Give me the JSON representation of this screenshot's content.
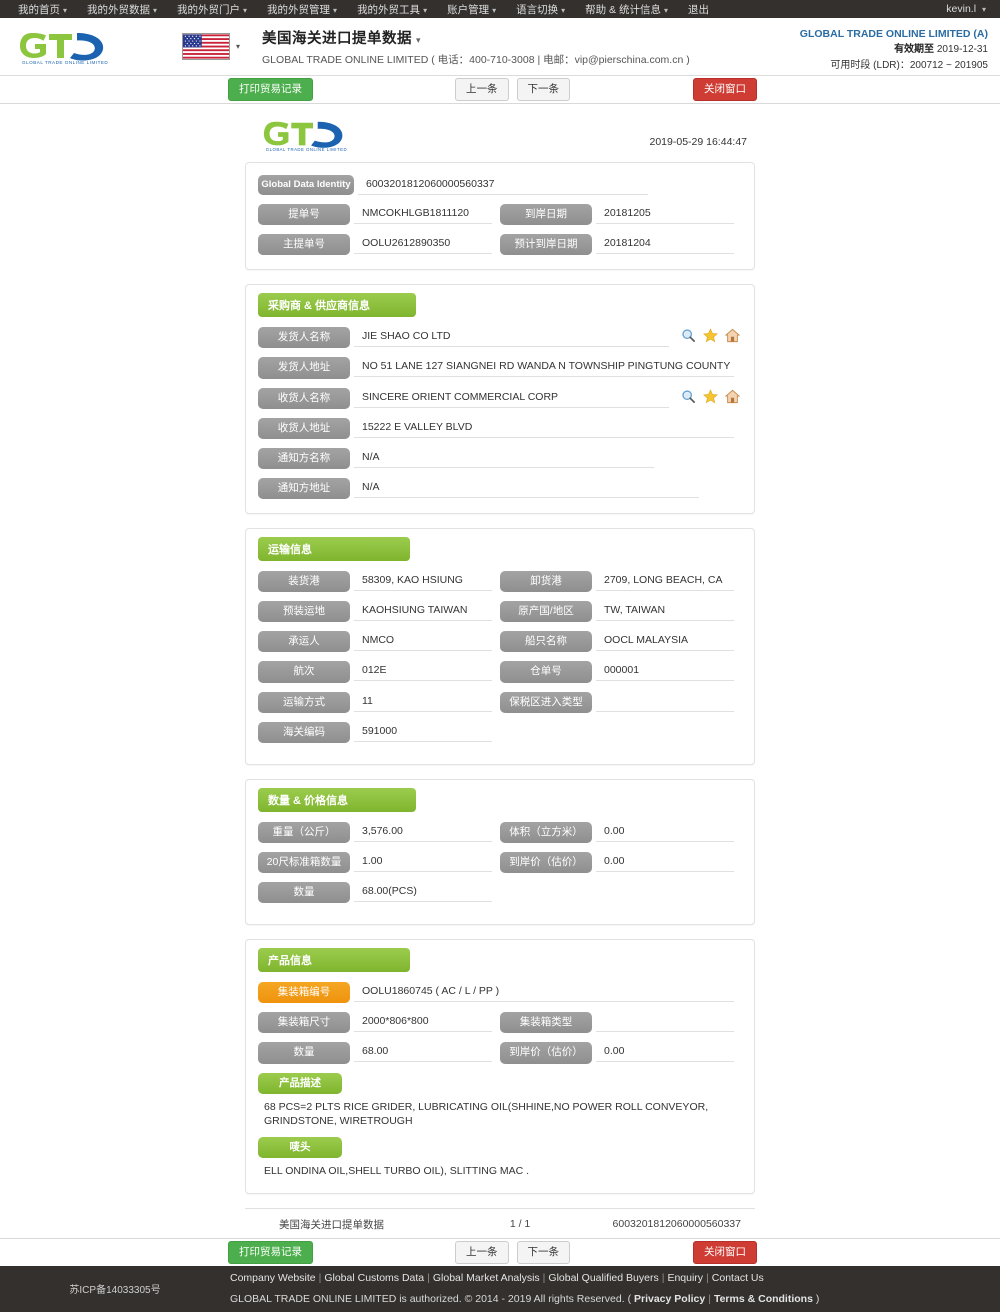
{
  "topnav": {
    "items": [
      {
        "label": "我的首页",
        "caret": true
      },
      {
        "label": "我的外贸数据",
        "caret": true
      },
      {
        "label": "我的外贸门户",
        "caret": true
      },
      {
        "label": "我的外贸管理",
        "caret": true
      },
      {
        "label": "我的外贸工具",
        "caret": true
      },
      {
        "label": "账户管理",
        "caret": true
      },
      {
        "label": "语言切换",
        "caret": true
      },
      {
        "label": "帮助 & 统计信息",
        "caret": true
      },
      {
        "label": "退出",
        "caret": false
      }
    ],
    "user": "kevin.l",
    "user_caret": "▾"
  },
  "header": {
    "logo_text": "GLOBAL TRADE ONLINE LIMITED",
    "flag": "us-flag-icon",
    "title": "美国海关进口提单数据",
    "title_caret": "▾",
    "subtitle": "GLOBAL TRADE ONLINE LIMITED ( 电话：400-710-3008 | 电邮：vip@pierschina.com.cn )",
    "account_name": "GLOBAL TRADE ONLINE LIMITED (A)",
    "valid_label": "有效期至",
    "valid_value": "2019-12-31",
    "ldr_label": "可用时段 (LDR)：",
    "ldr_value": "200712 ~ 201905"
  },
  "actionbar": {
    "print": "打印贸易记录",
    "prev": "上一条",
    "next": "下一条",
    "close": "关闭窗口"
  },
  "doc": {
    "timestamp": "2019-05-29 16:44:47",
    "identity": {
      "label": "Global Data Identity",
      "value": "6003201812060000560337"
    },
    "basic": [
      {
        "label": "提单号",
        "value": "NMCOKHLGB1811120"
      },
      {
        "label": "到岸日期",
        "value": "20181205"
      },
      {
        "label": "主提单号",
        "value": "OOLU2612890350"
      },
      {
        "label": "预计到岸日期",
        "value": "20181204"
      }
    ],
    "parties": {
      "title": "采购商 & 供应商信息",
      "fields": [
        {
          "label": "发货人名称",
          "value": "JIE SHAO CO LTD"
        },
        {
          "label": "发货人地址",
          "value": "NO 51 LANE 127 SIANGNEI RD WANDA N TOWNSHIP PINGTUNG COUNTY"
        },
        {
          "label": "收货人名称",
          "value": "SINCERE ORIENT COMMERCIAL CORP"
        },
        {
          "label": "收货人地址",
          "value": "15222 E VALLEY BLVD"
        },
        {
          "label": "通知方名称",
          "value": "N/A"
        },
        {
          "label": "通知方地址",
          "value": "N/A"
        }
      ],
      "icons": [
        "search-icon",
        "star-icon",
        "home-icon"
      ]
    },
    "transport": {
      "title": "运输信息",
      "fields": [
        {
          "label": "装货港",
          "value": "58309, KAO HSIUNG"
        },
        {
          "label": "卸货港",
          "value": "2709, LONG BEACH, CA"
        },
        {
          "label": "预装运地",
          "value": "KAOHSIUNG TAIWAN"
        },
        {
          "label": "原产国/地区",
          "value": "TW, TAIWAN"
        },
        {
          "label": "承运人",
          "value": "NMCO"
        },
        {
          "label": "船只名称",
          "value": "OOCL MALAYSIA"
        },
        {
          "label": "航次",
          "value": "012E"
        },
        {
          "label": "仓单号",
          "value": "000001"
        },
        {
          "label": "运输方式",
          "value": "11"
        },
        {
          "label": "保税区进入类型",
          "value": ""
        },
        {
          "label": "海关编码",
          "value": "591000"
        }
      ]
    },
    "quantity": {
      "title": "数量 & 价格信息",
      "fields": [
        {
          "label": "重量（公斤）",
          "value": "3,576.00"
        },
        {
          "label": "体积（立方米）",
          "value": "0.00"
        },
        {
          "label": "20尺标准箱数量",
          "value": "1.00"
        },
        {
          "label": "到岸价（估价）",
          "value": "0.00"
        },
        {
          "label": "数量",
          "value": "68.00(PCS)"
        }
      ]
    },
    "product": {
      "title": "产品信息",
      "container_no_label": "集装箱编号",
      "container_no_value": "OOLU1860745 ( AC / L / PP )",
      "fields": [
        {
          "label": "集装箱尺寸",
          "value": "2000*806*800"
        },
        {
          "label": "集装箱类型",
          "value": ""
        },
        {
          "label": "数量",
          "value": "68.00"
        },
        {
          "label": "到岸价（估价）",
          "value": "0.00"
        }
      ],
      "desc_label": "产品描述",
      "desc_value": "68 PCS=2 PLTS RICE GRIDER, LUBRICATING OIL(SHHINE,NO POWER ROLL CONVEYOR, GRINDSTONE, WIRETROUGH",
      "marks_label": "唛头",
      "marks_value": "ELL ONDINA OIL,SHELL TURBO OIL), SLITTING MAC ."
    },
    "footer": {
      "left": "美国海关进口提单数据",
      "center": "1 / 1",
      "right": "6003201812060000560337"
    }
  },
  "footer": {
    "icp": "苏ICP备14033305号",
    "links": [
      "Company Website",
      "Global Customs Data",
      "Global Market Analysis",
      "Global Qualified Buyers",
      "Enquiry",
      "Contact Us"
    ],
    "copyright": "GLOBAL TRADE ONLINE LIMITED is authorized. © 2014 - 2019 All rights Reserved.",
    "legal_open": "(",
    "legal_links": [
      "Privacy Policy",
      "Terms & Conditions"
    ],
    "legal_close": ")"
  },
  "colors": {
    "accent_green": "#8fbf3f",
    "accent_orange": "#f0a022",
    "label_gray": "#999999",
    "nav_dark": "#33302e",
    "link_blue": "#2b6ca3",
    "danger_red": "#cf3c34"
  }
}
